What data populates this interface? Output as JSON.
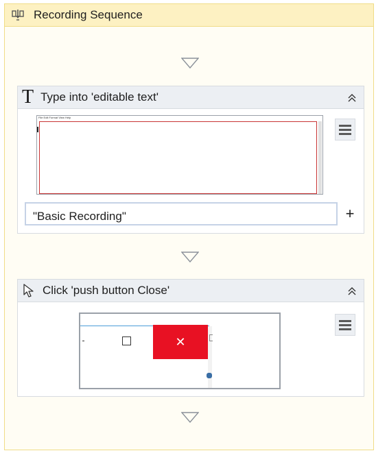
{
  "sequence": {
    "title": "Recording Sequence",
    "icon": "sequence-icon"
  },
  "activities": [
    {
      "title": "Type into 'editable text'",
      "icon": "type-into-T-icon",
      "input_value": "\"Basic Recording\"",
      "add_button_label": "+",
      "screenshot_menu_text": "File  Edit  Format  View  Help"
    },
    {
      "title": "Click 'push button  Close'",
      "icon": "pointer-cursor-icon",
      "screenshot_close_glyph": "✕"
    }
  ],
  "colors": {
    "sequence_border": "#f0dc86",
    "sequence_header_bg": "#fdf1c2",
    "activity_header_bg": "#eceff3",
    "close_button_red": "#e81123",
    "input_border": "#c5d2e6"
  }
}
